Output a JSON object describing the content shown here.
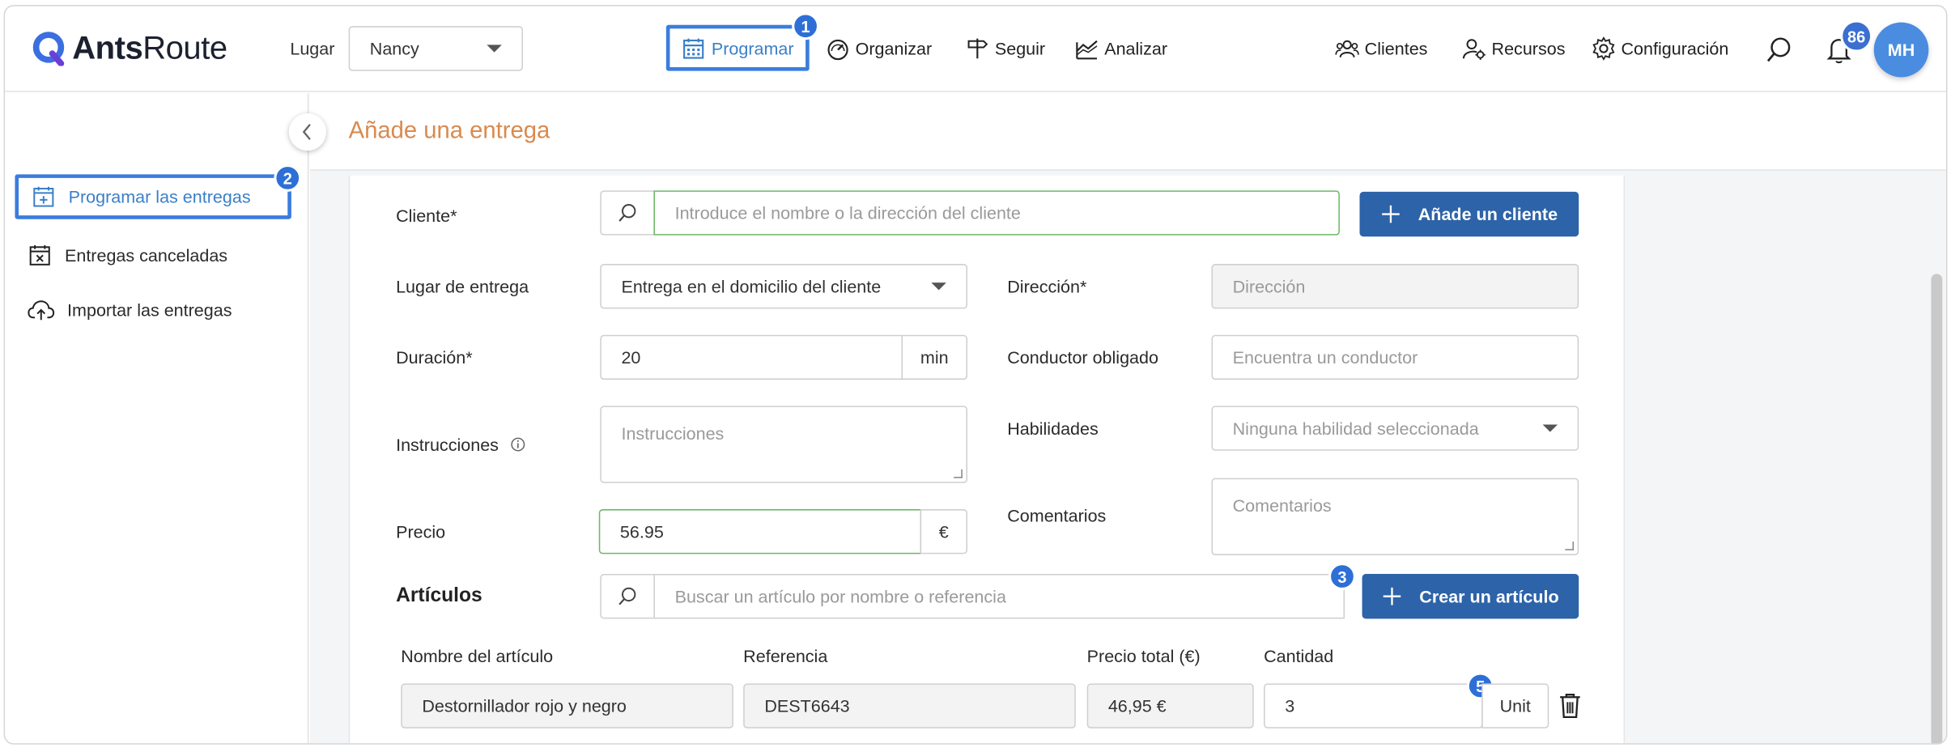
{
  "app": {
    "brand_bold": "Ants",
    "brand_light": "Route"
  },
  "header": {
    "place_label": "Lugar",
    "place_value": "Nancy",
    "nav": [
      {
        "label": "Programar",
        "icon": "calendar-icon"
      },
      {
        "label": "Organizar",
        "icon": "gauge-icon"
      },
      {
        "label": "Seguir",
        "icon": "signpost-icon"
      },
      {
        "label": "Analizar",
        "icon": "chart-icon"
      }
    ],
    "right_nav": [
      {
        "label": "Clientes",
        "icon": "users-icon"
      },
      {
        "label": "Recursos",
        "icon": "user-gear-icon"
      },
      {
        "label": "Configuración",
        "icon": "gear-icon"
      }
    ],
    "notifications_count": "86",
    "avatar_initials": "MH"
  },
  "annotations": {
    "a1": "1",
    "a2": "2",
    "a3": "3",
    "a5": "5"
  },
  "sidebar": {
    "items": [
      {
        "label": "Programar las entregas",
        "icon": "calendar-plus-icon"
      },
      {
        "label": "Entregas canceladas",
        "icon": "calendar-x-icon"
      },
      {
        "label": "Importar las entregas",
        "icon": "cloud-upload-icon"
      }
    ]
  },
  "page": {
    "title": "Añade una entrega"
  },
  "form": {
    "client_label": "Cliente*",
    "client_placeholder": "Introduce el nombre o la dirección del cliente",
    "add_client_label": "Añade un cliente",
    "place_label": "Lugar de entrega",
    "place_value": "Entrega en el domicilio del cliente",
    "address_label": "Dirección*",
    "address_placeholder": "Dirección",
    "duration_label": "Duración*",
    "duration_value": "20",
    "duration_unit": "min",
    "driver_label": "Conductor obligado",
    "driver_placeholder": "Encuentra un conductor",
    "instructions_label": "Instrucciones",
    "instructions_placeholder": "Instrucciones",
    "skills_label": "Habilidades",
    "skills_placeholder": "Ninguna habilidad seleccionada",
    "price_label": "Precio",
    "price_value": "56.95",
    "price_currency": "€",
    "comments_label": "Comentarios",
    "comments_placeholder": "Comentarios",
    "articles_label": "Artículos",
    "article_search_placeholder": "Buscar un artículo por nombre o referencia",
    "create_article_label": "Crear un artículo",
    "columns": {
      "name": "Nombre del artículo",
      "ref": "Referencia",
      "total": "Precio total (€)",
      "qty": "Cantidad"
    },
    "article_row": {
      "name": "Destornillador rojo y negro",
      "ref": "DEST6643",
      "total": "46,95 €",
      "qty": "3",
      "unit": "Unit"
    }
  },
  "colors": {
    "accent": "#3b7ddd",
    "button": "#2d63a8",
    "title": "#d98a4f",
    "link": "#3a7fc9"
  }
}
